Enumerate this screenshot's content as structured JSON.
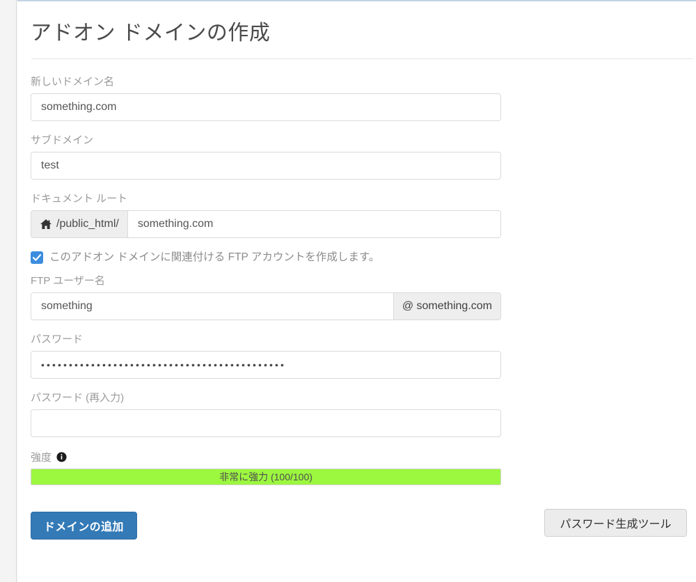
{
  "page": {
    "title": "アドオン ドメインの作成"
  },
  "form": {
    "new_domain": {
      "label": "新しいドメイン名",
      "value": "something.com"
    },
    "subdomain": {
      "label": "サブドメイン",
      "value": "test"
    },
    "document_root": {
      "label": "ドキュメント ルート",
      "prefix": "/public_html/",
      "prefix_icon": "home-icon",
      "value": "something.com"
    },
    "create_ftp": {
      "label": "このアドオン ドメインに関連付ける FTP アカウントを作成します。",
      "checked": true
    },
    "ftp_user": {
      "label": "FTP ユーザー名",
      "value": "something",
      "suffix": "@ something.com"
    },
    "password": {
      "label": "パスワード",
      "masked_value": "••••••••••••••••••••••••••••••••••••••••••••"
    },
    "password_confirm": {
      "label": "パスワード (再入力)",
      "value": ""
    },
    "strength": {
      "label": "強度",
      "info_icon": "info-icon",
      "text": "非常に強力 (100/100)",
      "score": 100,
      "max": 100,
      "percent": 100,
      "bar_color": "#9cf73f"
    },
    "generator_button": {
      "label": "パスワード生成ツール"
    },
    "submit_button": {
      "label": "ドメインの追加",
      "color": "#337ab7"
    }
  }
}
